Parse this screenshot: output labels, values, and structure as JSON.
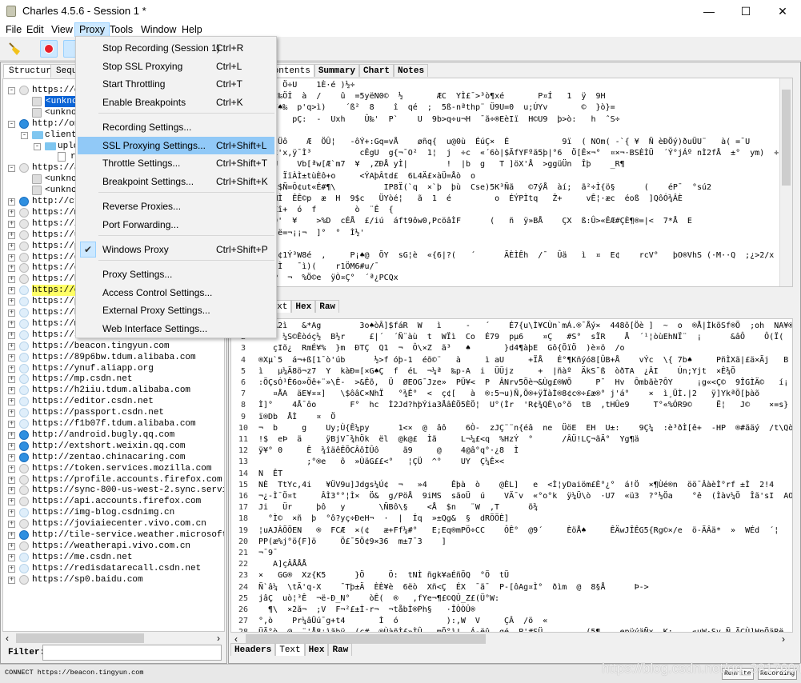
{
  "window": {
    "title": "Charles 4.5.6 - Session 1 *",
    "minimize": "—",
    "maximize": "☐",
    "close": "✕"
  },
  "menubar": [
    "File",
    "Edit",
    "View",
    "Proxy",
    "Tools",
    "Window",
    "Help"
  ],
  "proxy_menu": [
    {
      "label": "Stop Recording (Session 1)",
      "shortcut": "Ctrl+R"
    },
    {
      "label": "Stop SSL Proxying",
      "shortcut": "Ctrl+L"
    },
    {
      "label": "Start Throttling",
      "shortcut": "Ctrl+T"
    },
    {
      "label": "Enable Breakpoints",
      "shortcut": "Ctrl+K"
    },
    {
      "label": "Recording Settings...",
      "shortcut": ""
    },
    {
      "label": "SSL Proxying Settings...",
      "shortcut": "Ctrl+Shift+L"
    },
    {
      "label": "Throttle Settings...",
      "shortcut": "Ctrl+Shift+T"
    },
    {
      "label": "Breakpoint Settings...",
      "shortcut": "Ctrl+Shift+K"
    },
    {
      "label": "Reverse Proxies...",
      "shortcut": ""
    },
    {
      "label": "Port Forwarding...",
      "shortcut": ""
    },
    {
      "label": "Windows Proxy",
      "shortcut": "Ctrl+Shift+P",
      "checked": true
    },
    {
      "label": "Proxy Settings...",
      "shortcut": ""
    },
    {
      "label": "Access Control Settings...",
      "shortcut": ""
    },
    {
      "label": "External Proxy Settings...",
      "shortcut": ""
    },
    {
      "label": "Web Interface Settings...",
      "shortcut": ""
    }
  ],
  "left_tabs": [
    "Structure",
    "Seque"
  ],
  "tree": [
    {
      "label": "https://ety",
      "icon": "lock",
      "exp": "-",
      "d": 0
    },
    {
      "label": "<unknown",
      "icon": "doc",
      "d": 1,
      "sel": true
    },
    {
      "label": "<unknown",
      "icon": "doc",
      "d": 1
    },
    {
      "label": "http://onrt",
      "icon": "http",
      "exp": "-",
      "d": 0
    },
    {
      "label": "client",
      "icon": "folder",
      "exp": "-",
      "d": 1
    },
    {
      "label": "uplo",
      "icon": "folder",
      "exp": "-",
      "d": 2
    },
    {
      "label": "r",
      "icon": "file",
      "d": 3
    },
    {
      "label": "https://aud",
      "icon": "lock",
      "exp": "-",
      "d": 0
    },
    {
      "label": "<unknown",
      "icon": "doc",
      "d": 1
    },
    {
      "label": "<unknown",
      "icon": "doc",
      "d": 1
    },
    {
      "label": "http://ctl",
      "icon": "http",
      "exp": "+",
      "d": 0
    },
    {
      "label": "https://ma",
      "icon": "lock",
      "exp": "+",
      "d": 0
    },
    {
      "label": "https://im",
      "icon": "lock",
      "exp": "+",
      "d": 0
    },
    {
      "label": "https://up",
      "icon": "lock",
      "exp": "+",
      "d": 0
    },
    {
      "label": "https://pa",
      "icon": "lock",
      "exp": "+",
      "d": 0
    },
    {
      "label": "https://go",
      "icon": "lock",
      "exp": "+",
      "d": 0
    },
    {
      "label": "https://ev",
      "icon": "lock",
      "exp": "+",
      "d": 0
    },
    {
      "label": "https://hm",
      "icon": "lock",
      "exp": "+",
      "d": 0
    },
    {
      "label": "https://cs",
      "icon": "ssl",
      "exp": "+",
      "d": 0,
      "hl": true
    },
    {
      "label": "https://pr",
      "icon": "ssl",
      "exp": "+",
      "d": 0
    },
    {
      "label": "https://bi",
      "icon": "ssl",
      "exp": "+",
      "d": 0
    },
    {
      "label": "https://ms",
      "icon": "ssl",
      "exp": "+",
      "d": 0
    },
    {
      "label": "https://st",
      "icon": "ssl",
      "exp": "+",
      "d": 0
    },
    {
      "label": "https://beacon.tingyun.com",
      "icon": "ssl",
      "exp": "+",
      "d": 0
    },
    {
      "label": "https://89p6bw.tdum.alibaba.com",
      "icon": "ssl",
      "exp": "+",
      "d": 0
    },
    {
      "label": "https://ynuf.aliapp.org",
      "icon": "ssl",
      "exp": "+",
      "d": 0
    },
    {
      "label": "https://mp.csdn.net",
      "icon": "ssl",
      "exp": "+",
      "d": 0
    },
    {
      "label": "https://h2iiu.tdum.alibaba.com",
      "icon": "ssl",
      "exp": "+",
      "d": 0
    },
    {
      "label": "https://editor.csdn.net",
      "icon": "ssl",
      "exp": "+",
      "d": 0
    },
    {
      "label": "https://passport.csdn.net",
      "icon": "ssl",
      "exp": "+",
      "d": 0
    },
    {
      "label": "https://f1b07f.tdum.alibaba.com",
      "icon": "ssl",
      "exp": "+",
      "d": 0
    },
    {
      "label": "http://android.bugly.qq.com",
      "icon": "http",
      "exp": "+",
      "d": 0
    },
    {
      "label": "http://extshort.weixin.qq.com",
      "icon": "http",
      "exp": "+",
      "d": 0
    },
    {
      "label": "http://zentao.chinacaring.com",
      "icon": "http",
      "exp": "+",
      "d": 0
    },
    {
      "label": "https://token.services.mozilla.com",
      "icon": "lock",
      "exp": "+",
      "d": 0
    },
    {
      "label": "https://profile.accounts.firefox.com",
      "icon": "lock",
      "exp": "+",
      "d": 0
    },
    {
      "label": "https://sync-800-us-west-2.sync.services.mozil",
      "icon": "lock",
      "exp": "+",
      "d": 0
    },
    {
      "label": "https://api.accounts.firefox.com",
      "icon": "lock",
      "exp": "+",
      "d": 0
    },
    {
      "label": "https://img-blog.csdnimg.cn",
      "icon": "ssl",
      "exp": "+",
      "d": 0
    },
    {
      "label": "https://joviaiecenter.vivo.com.cn",
      "icon": "lock",
      "exp": "+",
      "d": 0
    },
    {
      "label": "http://tile-service.weather.microsoft.com",
      "icon": "http",
      "exp": "+",
      "d": 0
    },
    {
      "label": "https://weatherapi.vivo.com.cn",
      "icon": "lock",
      "exp": "+",
      "d": 0
    },
    {
      "label": "https://me.csdn.net",
      "icon": "ssl",
      "exp": "+",
      "d": 0
    },
    {
      "label": "https://redisdatarecall.csdn.net",
      "icon": "ssl",
      "exp": "+",
      "d": 0
    },
    {
      "label": "https://sp0.baidu.com",
      "icon": "lock",
      "exp": "+",
      "d": 0
    }
  ],
  "filter": {
    "label": "Filter:",
    "value": ""
  },
  "top_tabs": [
    "Contents",
    "Summary",
    "Chart",
    "Notes"
  ],
  "top_lines": [
    "    Æ  7  Ö÷U    1È·é )½÷",
    "{g¼v(♠×  ‰Öİ  à  /    û  =5yëN0©  ½       ÆC  YÌ£¯>³ò¶xé       P¤Í   1  ÿ  9H",
    " Ö}6  p!/♠‰  p'q>ì)    ´ß²  8    î  qé  ;  5ß-nªthp¨ Ü9U=0  u;ÚYv       ©  }ò}=",
    "v9àAu,¨     pÇ:  -  Uxh    Û‰'  P`    U  9b>q÷u¬H  ¯ã÷®EèIï  H©U9  þ>ò:   h  ˆS÷",
    "&Çö:",
    "8,Êµg    Üô    Æ  ÖÛ¦   -ôÝ+:Gq=vÅ    øñq{  u@0ù  ÉúÇ×  É           9ï  ( NOm( -`{ ¥  Ñ èÐÖý)ðuÜU¨   à( =¯U",
    "°  1ñ)øIx'x,ÿ¯Ì³          cÊgU  g{¬¯O²  1¦  j  ÷c  «´6ò|$ÃfYFºã5þ|°6  Ö[Ê×¬°  ¤×¬·BSÈÌÜ  ´Ý°jÁº nÌ2fÅ  ±°  ym)  ÷S",
    " ¹ìNC  9U    Vb[ªw[Æ`m7  ¥  ,ZÐÅ yÌ|        !  |b  g   T ]öX'Å  >ggüÜn  Îþ    _R¶",
    "ª  ëß'¦Ì  ÏïÀÌ±tùÈô+o     <ÝAþÂtd£  6L4Ä£×àÜ=Åò  o",
    "½  ÒU  ã¤$Ñ=Ô¢ut«É#¶\\          IP8Ï(`q  ×`þ  þù  Cse)5K³Ñã   ©7ýÅ  àí;  ã²÷Ì{ö§      (    éP¯  °sú2",
    ";UPÊ¦¯56MÌ  ÊÊ©p  æ  H  9$c   ÜYòé¦   ã  1  é         o  ÉÝPÌtq   Ž+     vÊ¦·æc  éoß  ]QôÓ¾ÂÈ",
    "Ò  RÛ   £î+  ó  f        ò  ¨Ê  {",
    "3#©GD  r9'  ¥    >%D  cÉÅ  £/iú  áft9ôw0,PcöâÌF      (   ñ  ÿ»BÅ    ÇX  ß:Û>«ÊÆ#ÇÈ¶®=|<  7*Å  E",
    "§  ÜÈ    ë=¬¡¡¬  ]°  °  Ì½'",
    " ÓÍtf♠",
    "{  ÒJÍf  ¢1Ý³W8é  ,     P¡♠@  ÕY  sG¦è  «{6|?(   ´      ÃÈÌÊh  /¯  Ûä   ì  ¤  E¢    rcV°   þO®VhS (·M··Q  ;¿>2/x",
    "ZCÖ,sb?  Ì   ¯ì)(    r1ÖM6#u/¯",
    "'ÿ¯   $sP  ¬  %Ö©e  ÿÒ¤Ç°  ´ª¿PCQx"
  ],
  "bottom_tabs": [
    "Headers",
    "Text",
    "Hex",
    "Raw"
  ],
  "bottom_lines": [
    "   Â2ì   &*Ag        3o♠òÂ]$fáR  W   ì     -   ´    É7{u\\Ì¥CÙn`mÁ.®¯Åý×  448õ[Öè ]  ~  o  ®Å|ÌkõSf®Ö  ;oh  NA¥®  ê2Ûà0  'ÁûYÛ",
    " ¹²  ¼S©Êòóç½  B½r     £|´  ´Ñ¨àù  t  WÏì  Co  É79  pµ6    ¤Ç   #S°  sÏR    Å  ´¹¦òùEhNÏ¨  ¡      &âÔ    Ô(Ï(    s°",
    "   çIõ¿  RmÉ¥%  }m  ÐTÇ  Q1  ¬  Ô\\×Z  ã³   ♠       }d4¶àþE  Gô{ÕïÖ  )è¤ö  /o",
    "®Xµ`5  á¬+ß[1¯ò'úb      ½>f óþ-1  éõ©¨   à     ì aU     +ÏÅ   É°¶Kñýó8[ÛB+Å    vÝc  \\{ 7b♠     PñÌXã|£ä×Ãj   B  ñ  Ès  ÑR¥",
    "ì   µ¼Ã8ö¬z7  Y  kàÐ=[×G♠Ç  f  éL  ¬¼ª  ‰p-A  i  ÜÜjz     +  |ñàº  ÄkS¯ß  òðTA  ¿ÂI    Ún;Yjt  ×Ê¾Õ",
    ":ÖÇsÓ¹Ê6o»Öê+¨»\\Ê-  >&Êõ,  Ü  ØEOG¯Jze»  PÜ¥<  P  ÂNrv5Öè¬&Ùg£®WÕ     P¯  Hv  Ômbãè?ÔY     ¡g«<Ç©  9ÎGÌÄ©   í¡  !©ç",
    "   ¤ÅA  äE¥¤¤]   \\$ôâC×NhÏ   °¾Ê°  <  ç¢[   à  ®:5¬u)Ñ,Ö®+ÿÏàÌ®8¢c®÷£æ®° j'á°    ×  ì¸ÜÌ.|2   ÿ]YkªÖ[þàõ          @  2",
    "Ì]°    4Å¯ôo       F°  hc  Ì2Jd?hþÝia3ÅâÈÖ5ÈÖ¦  U°(Ìr  'R¢¾QÈ\\o°õ  tB  ,tHÛe9     T°«%ÓR9©     Ë¦   J©    ×=s}   Ì  ³*8  [",
    "ï®Db  ÅÌ    ¤  Ö",
    "¬  b     g    Uy;Ù{Ê¼py      1<×  @  âô    6Ò-  zJÇ¨¨n{éâ  ne  ÜöE  EH  U±:    9Ç¼  :è³ðÌ[ê+  -HP  ®#ãäý  /t\\Qò  CÂ&  ©/;þ",
    "!$  eÞ  ä     ÿBjV¯¾hÖk  ël  @k@£  Ìã     L¬¼£<q  %HzÝ  °      /ÂÜ!LÇ¬ãÄ°  Yg¶ä",
    "ÿ¥° 0     Ê  ¾îäêÊÕCÂôÌÛô     ã9     @    4@â°q°·¿8  Ì",
    "          ;°®e   ô  »ÙäG££<°   ¦ÇÜ  ^°    UY  Ç¼Ê×<",
    "N  ÊT",
    "NÈ  TtYc,4i   ¥ÜV9u]Jdgs¼Ú¢  ¬   »4     Êþà  ò    @ÈL]   e  <Ì¦yDaiöm£È°¿°  á!Ö  ×¶Ùé®n  öö¯ÂàèÌ°rf ±Ì  2!4    V  Â¢£  wiÌz-ß°f¢",
    "¬¿-Ì¯Ö¤t     ÂÌ3°°¦Ì×  Ö&  g/PöÅ  9iMS  sãoÜ  ú    VÄ¯v  «°o°k  ÿ¼Ü\\ò  ·U7  «ü3  ?°½Öa    °ê  (Ìàv¼Ö  Îã'sI  AO-ó?Öö  !®Ì\\",
    "Ji   Ür     þô   y       \\ÑBô\\§    <Å  $n   ¨W  ,T      õ¾",
    "  °Ì©  ×ñ  þ  °ô?yç÷ÐeH¬  ·  |  Íq  »±Qg&  §  dRÖÖÈ]",
    "¦uAJÂÕÖEN   ®  FCÆ  ×(¢   æ+Ff¼#°   E;Eq®mPÖ÷CC    ÔÊ°  @9´     ÈöÅ♠     ÊÄwJÎÊG5{Rg©×/e  ö-ÃÂä*  »  WÉd  ´¦     #Nkó  ã%f=)",
    "PP(æ%j°ö{F]ö     Ö£¯5Ö¢9×36  m±7¯3    ]",
    "¬¯9¯",
    "   A]çÂÅÅÅ",
    "×   GG®  Xz{K5      }Ö     Ö:  tNÌ ñgk¥aÉñÖQ  °Ö  tÜ",
    "Ñ`â¼  \\tÃ'q-X    ¯Tþ±Ä  ÈÈ¥è  6ëò  Xñ<Ç  ÉX  ¯ã¯  P-[ôAg¤Ì°  ðìm  @  8§Å      Þ->",
    "jâÇ  uò¦³Ê  ¬ë-Ð_N°    òÊ(  ®   ,fYe¬¶£©QÛ_Z£(Ü°W:"
  ],
  "bottom_lines_more": [
    "  ¶\\  ×2ã¬  ;V  F¬²£±Ì-r¬  ¬tåbÌ®Ph§   ·ÎÒÒÛ®",
    "°,ò    Pr¼âÜú¯g+t4       Ì  ó          ):,W  V     ÇÂ  /ö  «",
    "ÜÃ°ò  @  ¨'Å8¡ìãþÿ  (c#  ®ÙàñÌ£»ÌÛ   mÕ°ì!  Á-ëû  gé  P'#SÜ         (5¶_   epÿýäÑx  K:    «uW·Sv Ñ.ÃÇÙ]HpÖäRë    \\  ,ÌÄç  ?Cn",
    "  g  þQó®  k  N  »ÊÊ£ìNtä£|Ì±Ê±     %  ;  ö  sBÿÖ    Å  ¥ê    ã  G'àÑ@l\\5·»a5Ìä´¿]   ´Çd|&  W  ©V°=,¢Ì£e-Ê®+×|Ì1¥"
  ],
  "status": {
    "text": "CONNECT https://beacon.tingyun.com",
    "rewrite": "Rewrite",
    "recording": "Recording"
  },
  "watermark": "https://blog.csdn.net/qq_38176040",
  "colors": {
    "menu_highlight": "#91c9f7",
    "tree_selection": "#0a64d6",
    "tree_highlight": "#ffff66",
    "record_button": "#e8202a"
  }
}
